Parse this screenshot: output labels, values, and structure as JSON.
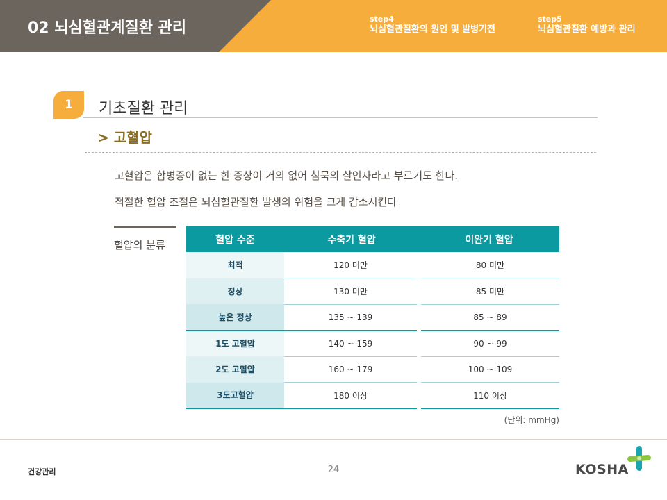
{
  "header": {
    "title": "02 뇌심혈관계질환 관리",
    "steps": [
      {
        "num": "step4",
        "label": "뇌심혈관질환의 원인 및 발병기전"
      },
      {
        "num": "step5",
        "label": "뇌심혈관질환 예방과 관리"
      }
    ]
  },
  "section": {
    "number": "1",
    "title": "기초질환 관리",
    "subtitle": "> 고혈압"
  },
  "paragraphs": [
    "고혈압은 합병증이 없는 한 증상이 거의 없어 침묵의 살인자라고 부르기도 한다.",
    "적절한 혈압 조절은 뇌심혈관질환 발생의 위험을 크게 감소시킨다"
  ],
  "classification": {
    "label": "혈압의 분류",
    "headers": [
      "혈압 수준",
      "수축기 혈압",
      "이완기 혈압"
    ],
    "rows": [
      {
        "level": "최적",
        "systolic": "120 미만",
        "diastolic": "80 미만"
      },
      {
        "level": "정상",
        "systolic": "130 미만",
        "diastolic": "85 미만"
      },
      {
        "level": "높은 정상",
        "systolic": "135 ~ 139",
        "diastolic": "85 ~ 89"
      },
      {
        "level": "1도 고혈압",
        "systolic": "140 ~ 159",
        "diastolic": "90 ~ 99"
      },
      {
        "level": "2도 고혈압",
        "systolic": "160 ~ 179",
        "diastolic": "100 ~ 109"
      },
      {
        "level": "3도고혈압",
        "systolic": "180 이상",
        "diastolic": "110 이상"
      }
    ],
    "unit": "(단위: mmHg)"
  },
  "footer": {
    "left": "건강관리",
    "page": "24",
    "logo_text": "KOSHA"
  },
  "colors": {
    "accent_orange": "#f6ad3c",
    "header_dark": "#6b655d",
    "table_teal": "#0a9aa0",
    "subtitle_gold": "#8a6d1f"
  }
}
